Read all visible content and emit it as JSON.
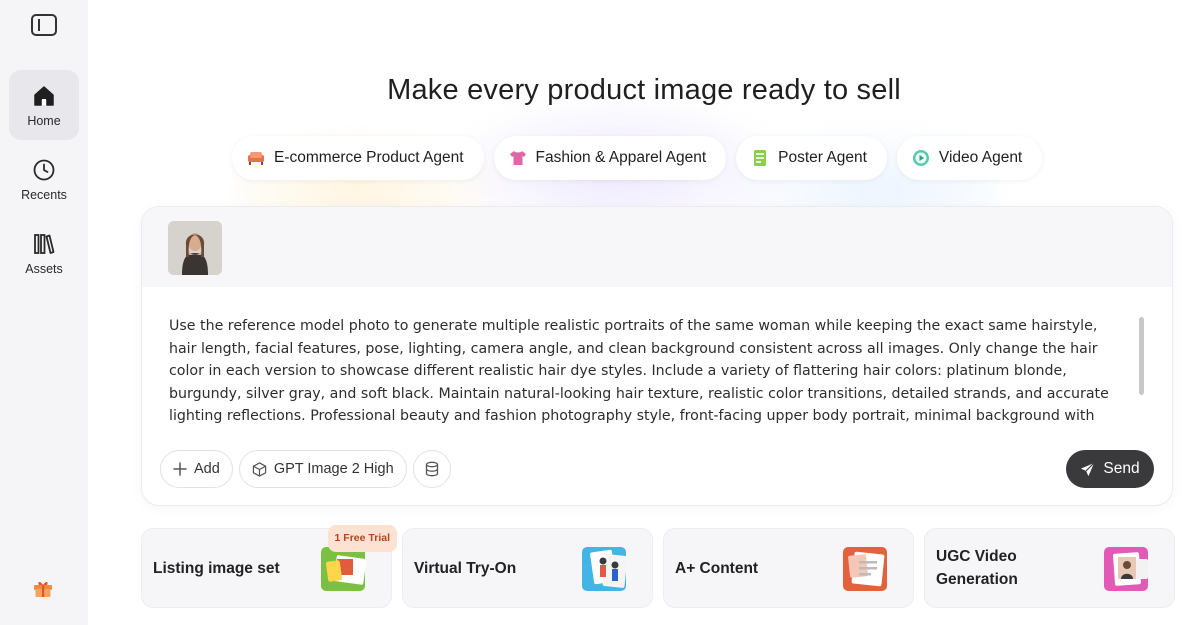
{
  "sidebar": {
    "items": [
      {
        "label": "Home",
        "icon": "home-icon",
        "active": true
      },
      {
        "label": "Recents",
        "icon": "clock-icon",
        "active": false
      },
      {
        "label": "Assets",
        "icon": "library-icon",
        "active": false
      }
    ],
    "bottom_icon": "gift-icon"
  },
  "main": {
    "title": "Make every product image ready to sell",
    "agents": [
      {
        "label": "E-commerce Product Agent",
        "icon": "sofa-icon"
      },
      {
        "label": "Fashion & Apparel Agent",
        "icon": "shirt-icon"
      },
      {
        "label": "Poster Agent",
        "icon": "poster-icon"
      },
      {
        "label": "Video Agent",
        "icon": "video-icon"
      }
    ]
  },
  "composer": {
    "attachment": "reference-model-thumbnail",
    "prompt": "Use the reference model photo to generate multiple realistic portraits of the same woman while keeping the exact same hairstyle, hair length, facial features, pose, lighting, camera angle, and clean background consistent across all images. Only change the hair color in each version to showcase different realistic hair dye styles. Include a variety of flattering hair colors: platinum blonde, burgundy, silver gray, and soft black. Maintain natural-looking hair texture, realistic color transitions, detailed strands, and accurate lighting reflections. Professional beauty and fashion photography style, front-facing upper body portrait, minimal background with no",
    "add_label": "Add",
    "model_label": "GPT Image 2 High",
    "send_label": "Send"
  },
  "cards": [
    {
      "label": "Listing image set",
      "badge": "1 Free Trial",
      "art_color": "#7bc043"
    },
    {
      "label": "Virtual Try-On",
      "badge": "",
      "art_color": "#42b4e6"
    },
    {
      "label": "A+ Content",
      "badge": "",
      "art_color": "#e2623d"
    },
    {
      "label": "UGC Video Generation",
      "badge": "",
      "art_color": "#e25ab5"
    }
  ],
  "colors": {
    "sidebar_bg": "#f5f5f7",
    "nav_active_bg": "#e7e7ec",
    "send_bg": "#3a3a3c",
    "badge_bg": "#fde1d2",
    "badge_text": "#b2451c"
  }
}
